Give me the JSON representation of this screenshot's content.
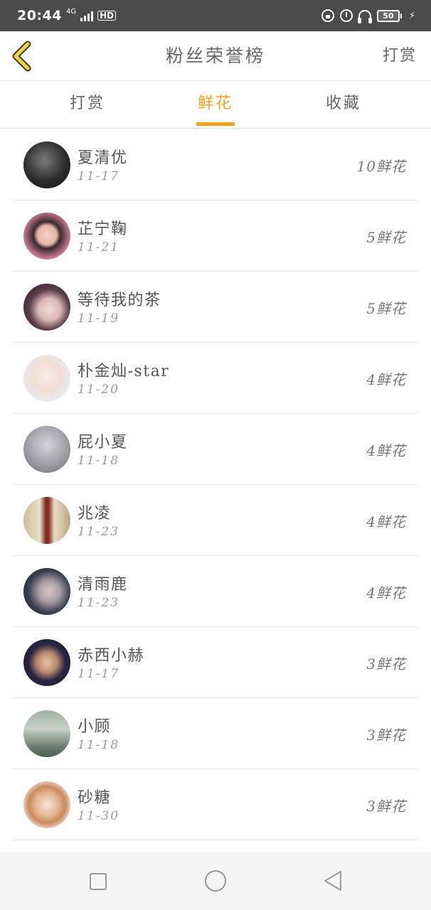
{
  "status_bar": {
    "time": "20:44",
    "network": "4G",
    "hd_label": "HD",
    "battery": "50",
    "icons": [
      "signal-icon",
      "lock-icon",
      "alarm-icon",
      "headphone-icon",
      "battery-icon",
      "charging-icon"
    ]
  },
  "header": {
    "title": "粉丝荣誉榜",
    "reward_label": "打赏",
    "back_icon": "chevron-left-icon",
    "accent_color": "#f0a21c"
  },
  "tabs": [
    {
      "label": "打赏"
    },
    {
      "label": "鲜花",
      "active": true
    },
    {
      "label": "收藏"
    }
  ],
  "fans": [
    {
      "name": "夏清优",
      "date": "11-17",
      "count": "10鲜花"
    },
    {
      "name": "芷宁鞠",
      "date": "11-21",
      "count": "5鲜花"
    },
    {
      "name": "等待我的茶",
      "date": "11-19",
      "count": "5鲜花"
    },
    {
      "name": "朴金灿-star",
      "date": "11-20",
      "count": "4鲜花"
    },
    {
      "name": "屁小夏",
      "date": "11-18",
      "count": "4鲜花"
    },
    {
      "name": "兆凌",
      "date": "11-23",
      "count": "4鲜花"
    },
    {
      "name": "清雨鹿",
      "date": "11-23",
      "count": "4鲜花"
    },
    {
      "name": "赤西小赫",
      "date": "11-17",
      "count": "3鲜花"
    },
    {
      "name": "小顾",
      "date": "11-18",
      "count": "3鲜花"
    },
    {
      "name": "砂糖",
      "date": "11-30",
      "count": "3鲜花"
    }
  ],
  "nav_bar": {
    "icons": [
      "recent-apps-icon",
      "home-icon",
      "back-icon"
    ]
  }
}
